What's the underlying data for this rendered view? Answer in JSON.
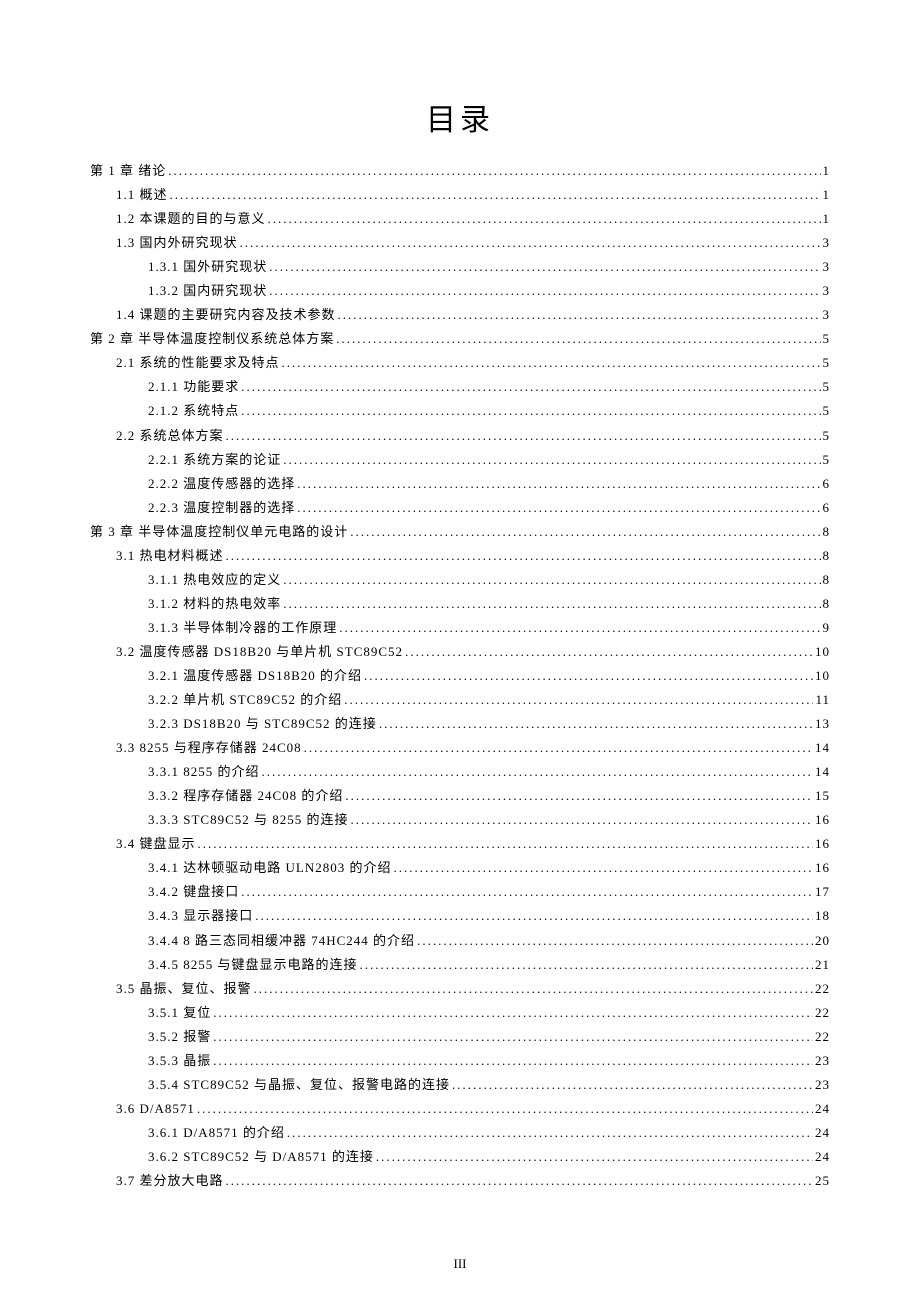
{
  "title": "目录",
  "page_number": "III",
  "entries": [
    {
      "level": 0,
      "label": "第 1 章 绪论",
      "page": "1"
    },
    {
      "level": 1,
      "label": "1.1 概述",
      "page": "1"
    },
    {
      "level": 1,
      "label": "1.2 本课题的目的与意义",
      "page": "1"
    },
    {
      "level": 1,
      "label": "1.3 国内外研究现状",
      "page": "3"
    },
    {
      "level": 2,
      "label": "1.3.1 国外研究现状",
      "page": "3"
    },
    {
      "level": 2,
      "label": "1.3.2 国内研究现状",
      "page": "3"
    },
    {
      "level": 1,
      "label": "1.4 课题的主要研究内容及技术参数",
      "page": "3"
    },
    {
      "level": 0,
      "label": "第 2 章 半导体温度控制仪系统总体方案",
      "page": "5"
    },
    {
      "level": 1,
      "label": "2.1 系统的性能要求及特点",
      "page": "5"
    },
    {
      "level": 2,
      "label": "2.1.1 功能要求",
      "page": "5"
    },
    {
      "level": 2,
      "label": "2.1.2 系统特点",
      "page": "5"
    },
    {
      "level": 1,
      "label": "2.2 系统总体方案",
      "page": "5"
    },
    {
      "level": 2,
      "label": "2.2.1 系统方案的论证",
      "page": "5"
    },
    {
      "level": 2,
      "label": "2.2.2 温度传感器的选择",
      "page": "6"
    },
    {
      "level": 2,
      "label": "2.2.3 温度控制器的选择",
      "page": "6"
    },
    {
      "level": 0,
      "label": "第 3 章 半导体温度控制仪单元电路的设计",
      "page": "8"
    },
    {
      "level": 1,
      "label": "3.1 热电材料概述",
      "page": "8"
    },
    {
      "level": 2,
      "label": "3.1.1 热电效应的定义",
      "page": "8"
    },
    {
      "level": 2,
      "label": "3.1.2 材料的热电效率",
      "page": "8"
    },
    {
      "level": 2,
      "label": "3.1.3 半导体制冷器的工作原理",
      "page": "9"
    },
    {
      "level": 1,
      "label": "3.2 温度传感器 DS18B20 与单片机 STC89C52",
      "page": "10"
    },
    {
      "level": 2,
      "label": "3.2.1 温度传感器 DS18B20 的介绍",
      "page": "10"
    },
    {
      "level": 2,
      "label": "3.2.2 单片机 STC89C52 的介绍",
      "page": "11"
    },
    {
      "level": 2,
      "label": "3.2.3 DS18B20 与 STC89C52 的连接",
      "page": "13"
    },
    {
      "level": 1,
      "label": "3.3 8255 与程序存储器 24C08",
      "page": "14"
    },
    {
      "level": 2,
      "label": "3.3.1 8255 的介绍",
      "page": "14"
    },
    {
      "level": 2,
      "label": "3.3.2 程序存储器 24C08 的介绍",
      "page": "15"
    },
    {
      "level": 2,
      "label": "3.3.3 STC89C52 与 8255 的连接",
      "page": "16"
    },
    {
      "level": 1,
      "label": "3.4 键盘显示",
      "page": "16"
    },
    {
      "level": 2,
      "label": "3.4.1 达林顿驱动电路 ULN2803 的介绍",
      "page": "16"
    },
    {
      "level": 2,
      "label": "3.4.2 键盘接口",
      "page": "17"
    },
    {
      "level": 2,
      "label": "3.4.3 显示器接口",
      "page": "18"
    },
    {
      "level": 2,
      "label": "3.4.4 8 路三态同相缓冲器 74HC244 的介绍",
      "page": "20"
    },
    {
      "level": 2,
      "label": "3.4.5 8255 与键盘显示电路的连接",
      "page": "21"
    },
    {
      "level": 1,
      "label": "3.5 晶振、复位、报警",
      "page": "22"
    },
    {
      "level": 2,
      "label": "3.5.1 复位",
      "page": "22"
    },
    {
      "level": 2,
      "label": "3.5.2 报警",
      "page": "22"
    },
    {
      "level": 2,
      "label": "3.5.3 晶振",
      "page": "23"
    },
    {
      "level": 2,
      "label": "3.5.4 STC89C52 与晶振、复位、报警电路的连接",
      "page": "23"
    },
    {
      "level": 1,
      "label": "3.6 D/A8571",
      "page": "24"
    },
    {
      "level": 2,
      "label": "3.6.1 D/A8571 的介绍",
      "page": "24"
    },
    {
      "level": 2,
      "label": "3.6.2 STC89C52 与 D/A8571 的连接",
      "page": "24"
    },
    {
      "level": 1,
      "label": "3.7 差分放大电路",
      "page": "25"
    }
  ]
}
